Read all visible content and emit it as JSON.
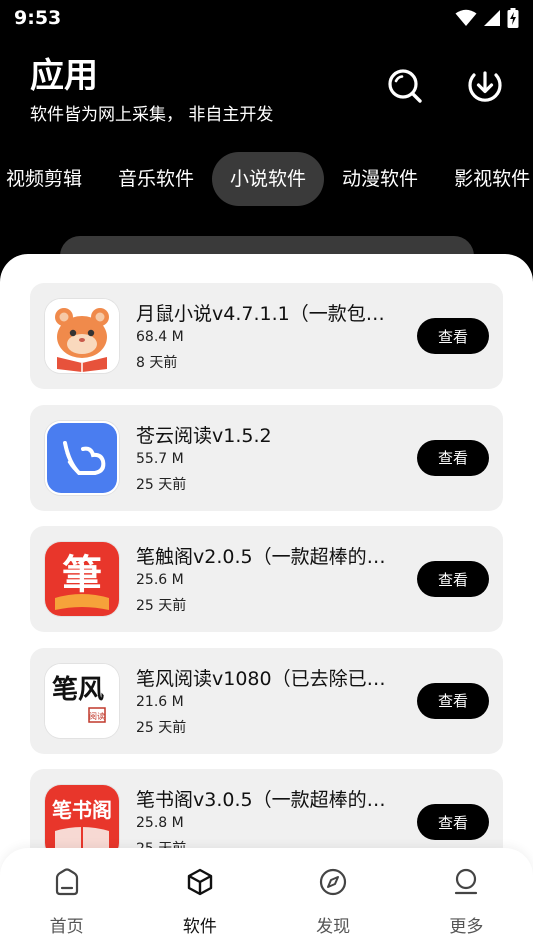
{
  "status_bar": {
    "time": "9:53"
  },
  "header": {
    "title": "应用",
    "subtitle": "软件皆为网上采集， 非自主开发"
  },
  "tabs": [
    {
      "label": "视频剪辑",
      "active": false
    },
    {
      "label": "音乐软件",
      "active": false
    },
    {
      "label": "小说软件",
      "active": true
    },
    {
      "label": "动漫软件",
      "active": false
    },
    {
      "label": "影视软件",
      "active": false
    }
  ],
  "apps": [
    {
      "name": "月鼠小说v4.7.1.1（一款包…",
      "size": "68.4 M",
      "time": "8 天前",
      "button": "查看",
      "icon": "hamster-book-icon"
    },
    {
      "name": "苍云阅读v1.5.2",
      "size": "55.7 M",
      "time": "25 天前",
      "button": "查看",
      "icon": "cloud-book-icon"
    },
    {
      "name": "笔触阁v2.0.5（一款超棒的…",
      "size": "25.6 M",
      "time": "25 天前",
      "button": "查看",
      "icon": "bi-character-book-icon",
      "icon_text": "筆"
    },
    {
      "name": "笔风阅读v1080（已去除已…",
      "size": "21.6 M",
      "time": "25 天前",
      "button": "查看",
      "icon": "calligraphy-icon",
      "icon_text": "笔风",
      "icon_seal": "阅读"
    },
    {
      "name": "笔书阁v3.0.5（一款超棒的…",
      "size": "25.8 M",
      "time": "25 天前",
      "button": "查看",
      "icon": "bishuge-icon",
      "icon_text": "笔书阁"
    }
  ],
  "bottom_nav": [
    {
      "label": "首页",
      "icon": "home-icon",
      "active": false
    },
    {
      "label": "软件",
      "icon": "cube-icon",
      "active": true
    },
    {
      "label": "发现",
      "icon": "compass-icon",
      "active": false
    },
    {
      "label": "更多",
      "icon": "profile-icon",
      "active": false
    }
  ],
  "colors": {
    "accent": "#000000",
    "card": "#f0f0f0",
    "tab_active": "#3a3a3a"
  }
}
